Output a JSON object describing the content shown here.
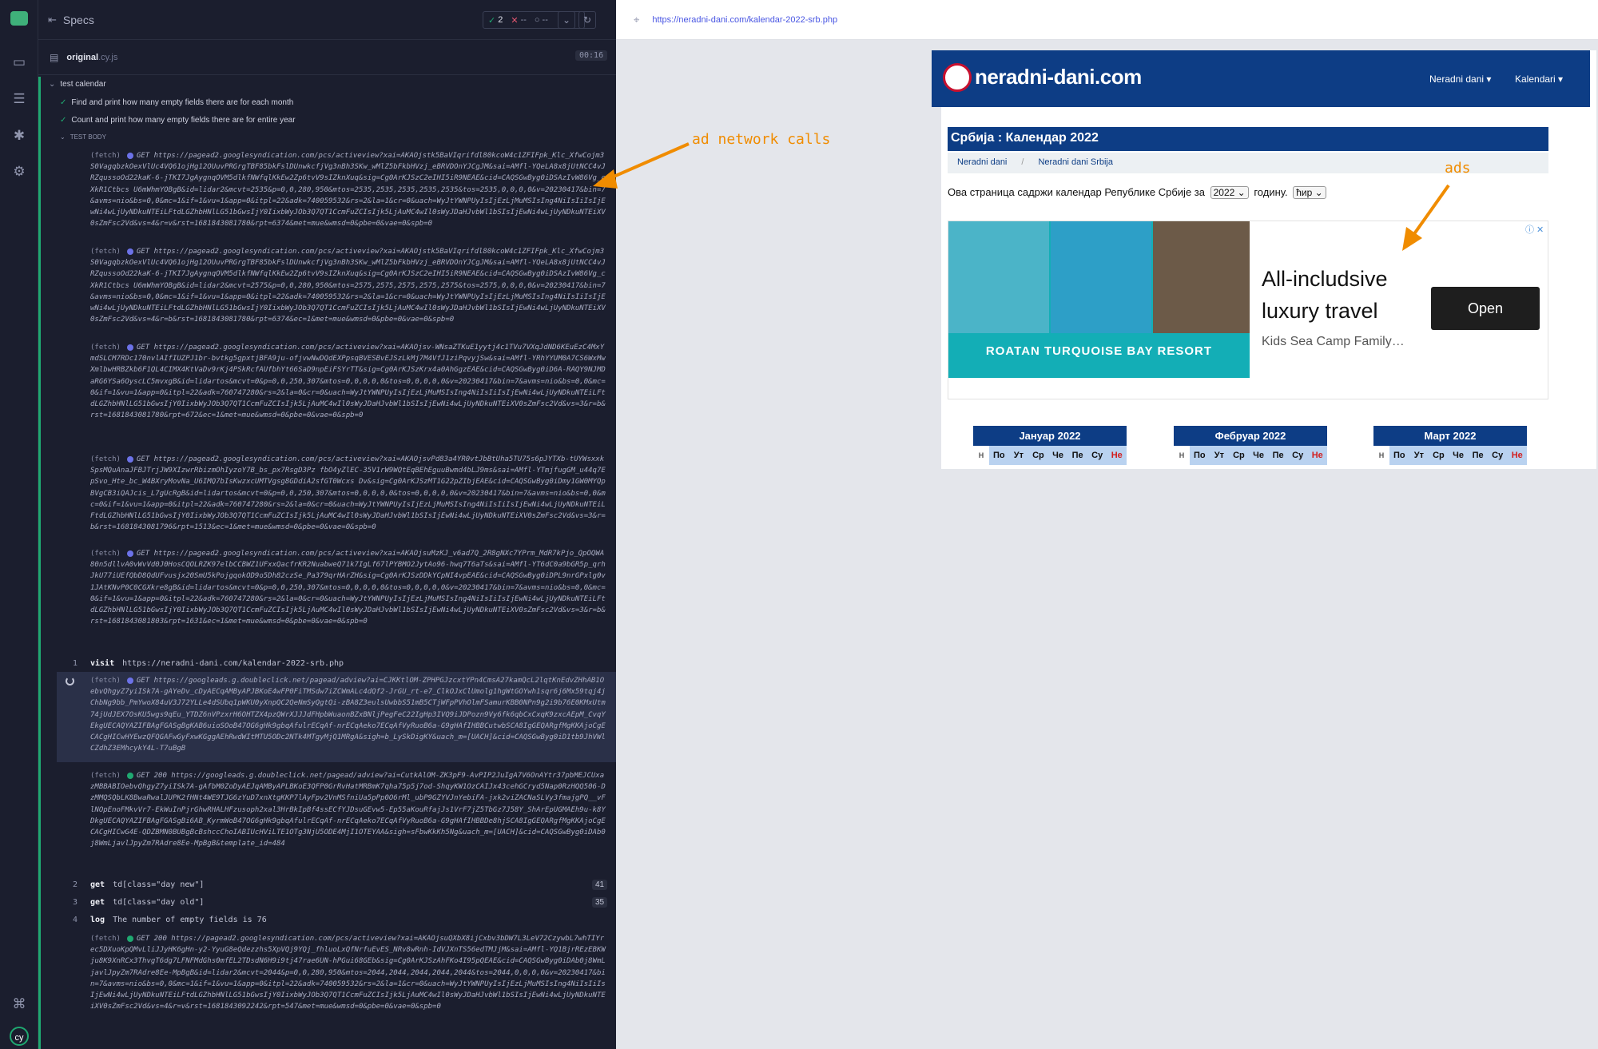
{
  "reporter": {
    "specs_label": "Specs",
    "stats": {
      "passed": "2",
      "failed": "--",
      "pending": "--"
    },
    "file": {
      "name": "original",
      "ext": ".cy.js",
      "duration": "00:16"
    },
    "suite_title": "test calendar",
    "tests": [
      "Find and print how many empty fields there are for each month",
      "Count and print how many empty fields there are for entire year"
    ],
    "body_label": "TEST BODY",
    "fetch_label": "(fetch)",
    "fetch_blocks": [
      {
        "method": "GET",
        "text": "https://pagead2.googlesyndication.com/pcs/activeview?xai=AKAOjstk5BaVIqrifdl80kcoW4c1ZFIFpk_Klc_XfwCojm3S0VagqbzkOexVlUc4VQ61ojHg12OUuvPRGrgTBF85bkFslDUnwkcfjVg3nBh3SKw_wMlZ5bFkbHVzj_eBRVDOnYJCgJM&sai=AMfl-YQeLA8x8jUtNCC4vJRZqussoOd22kaK-6-jTKI7JgAygnqOVM5dlkfNWfqlKkEw2Zp6tvV9sIZknXuq&sig=Cg0ArKJSzC2eIHI5iR9NEAE&cid=CAQSGwByg0iDSAzIvW86Vg_cXkR1Ctbcs U6mWhmYOBgB&id=lidar2&mcvt=2535&p=0,0,280,950&mtos=2535,2535,2535,2535,2535&tos=2535,0,0,0,0&v=20230417&bin=7&avms=nio&bs=0,0&mc=1&if=1&vu=1&app=0&itpl=22&adk=740059532&rs=2&la=1&cr=0&uach=WyJtYWNPUyIsIjEzLjMuMSIsIng4NiIsIiIsIjEwNi4wLjUyNDkuNTEiLFtdLGZhbHNlLG51bGwsIjY0IixbWyJOb3Q7QT1CcmFuZCIsIjk5LjAuMC4wIl0sWyJDaHJvbWl1bSIsIjEwNi4wLjUyNDkuNTEiXV0sZmFsc2Vd&vs=4&r=v&rst=1681843081780&rpt=6374&met=mue&wmsd=0&pbe=0&vae=0&spb=0"
      },
      {
        "method": "GET",
        "text": "https://pagead2.googlesyndication.com/pcs/activeview?xai=AKAOjstk5BaVIqrifdl80kcoW4c1ZFIFpk_Klc_XfwCojm3S0VagqbzkOexVlUc4VQ61ojHg12OUuvPRGrgTBF85bkFslDUnwkcfjVg3nBh3SKw_wMlZ5bFkbHVzj_eBRVDOnYJCgJM&sai=AMfl-YQeLA8x8jUtNCC4vJRZqussoOd22kaK-6-jTKI7JgAygnqOVM5dlkfNWfqlKkEw2Zp6tvV9sIZknXuq&sig=Cg0ArKJSzC2eIHI5iR9NEAE&cid=CAQSGwByg0iDSAzIvW86Vg_cXkR1Ctbcs U6mWhmYOBgB&id=lidar2&mcvt=2575&p=0,0,280,950&mtos=2575,2575,2575,2575,2575&tos=2575,0,0,0,0&v=20230417&bin=7&avms=nio&bs=0,0&mc=1&if=1&vu=1&app=0&itpl=22&adk=740059532&rs=2&la=1&cr=0&uach=WyJtYWNPUyIsIjEzLjMuMSIsIng4NiIsIiIsIjEwNi4wLjUyNDkuNTEiLFtdLGZhbHNlLG51bGwsIjY0IixbWyJOb3Q7QT1CcmFuZCIsIjk5LjAuMC4wIl0sWyJDaHJvbWl1bSIsIjEwNi4wLjUyNDkuNTEiXV0sZmFsc2Vd&vs=4&r=b&rst=1681843081780&rpt=6374&ec=1&met=mue&wmsd=0&pbe=0&vae=0&spb=0"
      },
      {
        "method": "GET",
        "text": "https://pagead2.googlesyndication.com/pcs/activeview?xai=AKAOjsv-WNsaZTKuE1yytj4c1TVu7VXqJdND6KEuEzC4MxYmdSLCM7RDc170nvlAIfIUZPJ1br-bvtkg5gpxtjBFA9ju-ofjvwNwDQdEXPpsqBVESBvEJSzLkMj7M4VfJ1ziPqvyjSw&sai=AMfl-YRhYYUM0A7CS6WxMwXmlbwHRBZkb6F1QL4CIMX4KtVaDv9rKj4PSkRcfAUfbhYt66SaD9npEiFSYrTT&sig=Cg0ArKJSzKrx4a0AhGgzEAE&cid=CAQSGwByg0iD6A-RAQY9NJMDaRG6YSa6OyscLC5mvxgB&id=lidartos&mcvt=0&p=0,0,250,307&mtos=0,0,0,0,0&tos=0,0,0,0,0&v=20230417&bin=7&avms=nio&bs=0,0&mc=0&if=1&vu=1&app=0&itpl=22&adk=760747280&rs=2&la=0&cr=0&uach=WyJtYWNPUyIsIjEzLjMuMSIsIng4NiIsIiIsIjEwNi4wLjUyNDkuNTEiLFtdLGZhbHNlLG51bGwsIjY0IixbWyJOb3Q7QT1CcmFuZCIsIjk5LjAuMC4wIl0sWyJDaHJvbWl1bSIsIjEwNi4wLjUyNDkuNTEiXV0sZmFsc2Vd&vs=3&r=b&rst=1681843081780&rpt=672&ec=1&met=mue&wmsd=0&pbe=0&vae=0&spb=0"
      },
      {
        "method": "GET",
        "text": "https://pagead2.googlesyndication.com/pcs/activeview?xai=AKAOjsvPd83a4YR0vtJbBtUha5TU75s6pJYTXb-tUYWsxxkSpsMQuAnaJFBJTrjJW9XIzwrRbizmOhIyzoY7B_bs_px7RsgD3Pz fbO4yZlEC-35V1rW9WQtEqBEhEguuBwmd4bLJ9ms&sai=AMfl-YTmjfugGM_u44q7EpSvo_Hte_bc_W4BXryMovNa_U6IMQ7bIsKwzxcUMTVgsg8GDdiA2sfGT0Wcxs Dv&sig=Cg0ArKJSzMT1G22pZIbjEAE&cid=CAQSGwByg0iDmy1GW0MYQpBVgCB3iQAJcis_L7gUcRgB&id=lidartos&mcvt=0&p=0,0,250,307&mtos=0,0,0,0,0&tos=0,0,0,0,0&v=20230417&bin=7&avms=nio&bs=0,0&mc=0&if=1&vu=1&app=0&itpl=22&adk=760747280&rs=2&la=0&cr=0&uach=WyJtYWNPUyIsIjEzLjMuMSIsIng4NiIsIiIsIjEwNi4wLjUyNDkuNTEiLFtdLGZhbHNlLG51bGwsIjY0IixbWyJOb3Q7QT1CcmFuZCIsIjk5LjAuMC4wIl0sWyJDaHJvbWl1bSIsIjEwNi4wLjUyNDkuNTEiXV0sZmFsc2Vd&vs=3&r=b&rst=1681843081796&rpt=1513&ec=1&met=mue&wmsd=0&pbe=0&vae=0&spb=0"
      },
      {
        "method": "GET",
        "text": "https://pagead2.googlesyndication.com/pcs/activeview?xai=AKAOjsuMzKJ_v6ad7Q_2R8gNXc7YPrm_MdR7kPjo_QpOQWA80n5dllvA0vWvVd0J0HosCQOLRZK97elbCCBWZ1UFxxQacfrKR2NuabweQ71k7IgLf67lPYBMO2JytAo96-hwq7T6aTs&sai=AMfl-YT6dC0a9bGR5p_qrhJkU77iUEfQbD8QdUFvusjx20SmU5kPojgqokOD9o5Dh82czSe_Pa379qrHArZH&sig=Cg0ArKJSzDDkYCpNI4vpEAE&cid=CAQSGwByg0iDPL9nrGPxlg0v1JAtKNvP0C0CGXkre8gB&id=lidartos&mcvt=0&p=0,0,250,307&mtos=0,0,0,0,0&tos=0,0,0,0,0&v=20230417&bin=7&avms=nio&bs=0,0&mc=0&if=1&vu=1&app=0&itpl=22&adk=760747280&rs=2&la=0&cr=0&uach=WyJtYWNPUyIsIjEzLjMuMSIsIng4NiIsIiIsIjEwNi4wLjUyNDkuNTEiLFtdLGZhbHNlLG51bGwsIjY0IixbWyJOb3Q7QT1CcmFuZCIsIjk5LjAuMC4wIl0sWyJDaHJvbWl1bSIsIjEwNi4wLjUyNDkuNTEiXV0sZmFsc2Vd&vs=3&r=b&rst=1681843081803&rpt=1631&ec=1&met=mue&wmsd=0&pbe=0&vae=0&spb=0"
      }
    ],
    "visit": {
      "keyword": "visit",
      "url": "https://neradni-dani.com/kalendar-2022-srb.php"
    },
    "fetch_doubleclick_pending": {
      "method": "GET",
      "text": "https://googleads.g.doubleclick.net/pagead/adview?ai=CJKKtlOM-ZPHPGJzcxtYPn4CmsA27kamQcL2lqtKnEdvZHhAB1OebvQhgyZ7yiISk7A-gAYeDv_cDyAECqAMByAPJBKoE4wFP0FiTMSdw7iZCWmALc4dQf2-JrGU_rt-e7_ClkOJxClUmolg1hgWtGOYwh1sqr6j6Mx59tqj4jChbNg9bb_PmYwoX84uV3J72YLLe4dSUbq1pWKU0yXnpQC2QeNmSyQgtQi-zBA8Z3eulsUwbbS51mB5CTjWFpPVhOlmFSamurKBB0NPn9g2i9b76E0KMxUtm74jUdJEX7OsKU5wgs9qEu_YTDZ6nVPzxrH6OHTZX4pzQWrXJJJdFHpbWuaonBZxBNljPegFeC22IgHp3IVQ9iJDPozn9Vy6fk6qbCxCxqK9zxcAEpM_CvqYEkgUECAQYAZIFBAgFGASgBgKAB6uioSOoB47OG6gHk9gbqAfulrECqAf-nrECqAeko7ECqAfVyRuoB6a-G9gHAfIHBBCutwbSCA8IgGEQARgfMgKKAjoCgECACgHICwHYEwzQFQGAFwGyFxwKGggAEhRwdWItMTU5ODc2NTk4MTgyMjQ1MRgA&sigh=b_LySkDigKY&uach_m=[UACH]&cid=CAQSGwByg0iD1tb9JhVWlCZdhZ3EMhcykY4L-T7uBgB"
    },
    "fetch_doubleclick_200": {
      "method": "GET 200",
      "text": "https://googleads.g.doubleclick.net/pagead/adview?ai=CutkAlOM-ZK3pF9-AvPIP2JuIgA7V6OnAYtr37pbMEJCUxazMBBABIOebvQhgyZ7yiISk7A-gAfbM0ZoDyAEJqAMByAPLBKoE3QFP0GrRvHatMRBmK7qha75p5j7od-ShqyKW1OzCAIJx43cehGCryd5Nap0RzHQQ506-DzMMQSQbLK8BwaRwalJUPK2fHNt4WE9TJG6zYuD7xnXtgKKP7lAyFpv2VnMSfniUa5pPp0O6rMl_ubP9GZYVJnYebiFA-jxk2viZACNaSLVy3fmajgPQ__vFlNOpEnoFMkvVr7-EkWuInPjrGhwRHALHFzusoph2xal3HrBkIpBf4ssECfYJDsuGEvw5-Ep55aKouRfajJs1VrF7jZ5TbGz7J58Y_ShArEpUGMAEh9u-k8YDkgUECAQYAZIFBAgFGASgBi6AB_KyrmWoB47OG6gHk9gbqAfulrECqAf-nrECqAeko7ECqAfVyRuoB6a-G9gHAfIHBBDe8hjSCA8IgGEQARgfMgKKAjoCgECACgHICwG4E-QDZBMN0BUBgBcBshccChoIABIUcHViLTE1OTg3NjU5ODE4MjI1OTEYAA&sigh=sFbwKkKh5Ng&uach_m=[UACH]&cid=CAQSGwByg0iDAb0j8WmLjavlJpyZm7RAdre8Ee-MpBgB&template_id=484"
    },
    "commands": [
      {
        "num": "2",
        "keyword": "get",
        "arg": "td[class=\"day new\"]",
        "count": "41"
      },
      {
        "num": "3",
        "keyword": "get",
        "arg": "td[class=\"day old\"]",
        "count": "35"
      },
      {
        "num": "4",
        "keyword": "log",
        "arg": "The number of empty fields is 76",
        "count": ""
      }
    ],
    "fetch_last": {
      "method": "GET 200",
      "text": "https://pagead2.googlesyndication.com/pcs/activeview?xai=AKAOjsuQXbX8ijCxbv3bDW7L3LeV72CzywbL7whTIYrec5DXuoKpQMvLliJJyHK6gHn-y2-YyuG8eQdezzhs5XpVQj9YQj_fhluoLxQfNrfuEvES_NRv8wRnh-IdVJXnTS56edTMJjM&sai=AMfl-YQ1BjrREzEBKWju8K9XnRCx3ThvgT6dg7LFNFMdGhs0mfEL2TDsdN6H9i9tj47rae6UN-hPGui68GEb&sig=Cg0ArKJSzAhFKo4I95pQEAE&cid=CAQSGwByg0iDAb0j8WmLjavlJpyZm7RAdre8Ee-MpBgB&id=lidar2&mcvt=2044&p=0,0,280,950&mtos=2044,2044,2044,2044,2044&tos=2044,0,0,0,0&v=20230417&bin=7&avms=nio&bs=0,0&mc=1&if=1&vu=1&app=0&itpl=22&adk=740059532&rs=2&la=1&cr=0&uach=WyJtYWNPUyIsIjEzLjMuMSIsIng4NiIsIiIsIjEwNi4wLjUyNDkuNTEiLFtdLGZhbHNlLG51bGwsIjY0IixbWyJOb3Q7QT1CcmFuZCIsIjk5LjAuMC4wIl0sWyJDaHJvbWl1bSIsIjEwNi4wLjUyNDkuNTEiXV0sZmFsc2Vd&vs=4&r=v&rst=1681843092242&rpt=547&met=mue&wmsd=0&pbe=0&vae=0&spb=0"
    }
  },
  "aut": {
    "url": "https://neradni-dani.com/kalendar-2022-srb.php",
    "brand": "neradni-dani.com",
    "nav": [
      "Neradni dani",
      "Kalendari"
    ],
    "page_title": "Србија : Календар 2022",
    "breadcrumbs": [
      "Neradni dani",
      "Neradni dani Srbija"
    ],
    "intro_before": "Ова страница садржи календар Републике Србије за",
    "year_select": "2022",
    "intro_mid": "годину.",
    "script_select": "ћир",
    "ad": {
      "banner": "ROATAN TURQUOISE BAY RESORT",
      "headline": "All-includsive luxury travel",
      "sub": "Kids Sea Camp Family…",
      "cta": "Open",
      "info": "ⓘ ✕"
    },
    "months": [
      "Јануар 2022",
      "Фебруар 2022",
      "Март 2022"
    ],
    "week_label": "Н",
    "weekdays": [
      "По",
      "Ут",
      "Ср",
      "Че",
      "Пе",
      "Су",
      "Не"
    ]
  },
  "annotations": {
    "network": "ad network calls",
    "ads": "ads"
  },
  "colors": {
    "accent_green": "#1fa971",
    "site_blue": "#0d3d85",
    "annotation": "#f08c00"
  }
}
